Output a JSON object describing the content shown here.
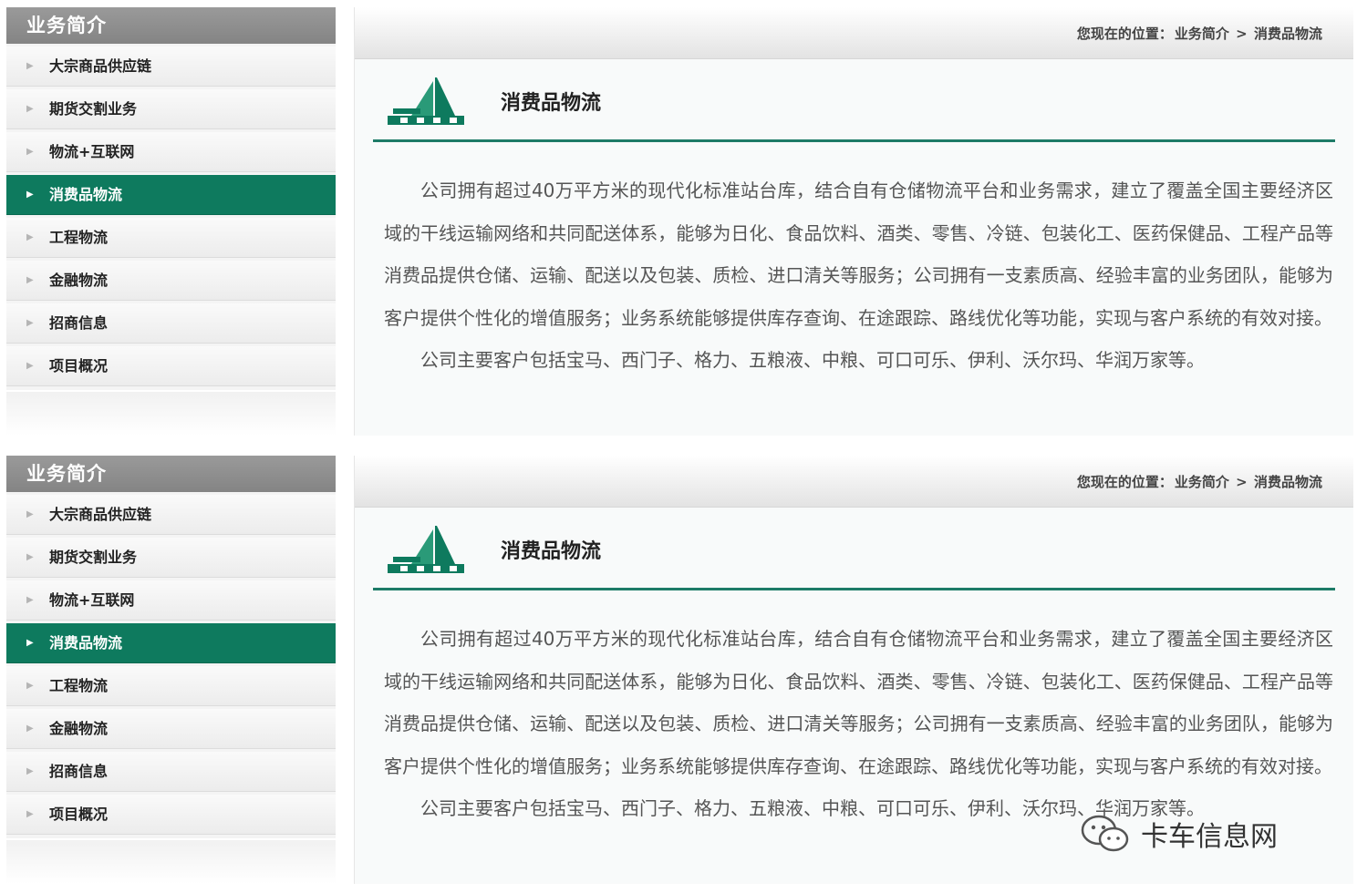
{
  "sidebar": {
    "title": "业务简介",
    "items": [
      {
        "label": "大宗商品供应链",
        "active": false
      },
      {
        "label": "期货交割业务",
        "active": false
      },
      {
        "label": "物流+互联网",
        "active": false
      },
      {
        "label": "消费品物流",
        "active": true
      },
      {
        "label": "工程物流",
        "active": false
      },
      {
        "label": "金融物流",
        "active": false
      },
      {
        "label": "招商信息",
        "active": false
      },
      {
        "label": "项目概况",
        "active": false
      }
    ]
  },
  "breadcrumb": {
    "prefix": "您现在的位置：",
    "parent": "业务简介",
    "separator": ">",
    "current": "消费品物流"
  },
  "page_title": "消费品物流",
  "paragraphs": [
    "公司拥有超过40万平方米的现代化标准站台库，结合自有仓储物流平台和业务需求，建立了覆盖全国主要经济区域的干线运输网络和共同配送体系，能够为日化、食品饮料、酒类、零售、冷链、包装化工、医药保健品、工程产品等消费品提供仓储、运输、配送以及包装、质检、进口清关等服务；公司拥有一支素质高、经验丰富的业务团队，能够为客户提供个性化的增值服务；业务系统能够提供库存查询、在途跟踪、路线优化等功能，实现与客户系统的有效对接。",
    "公司主要客户包括宝马、西门子、格力、五粮液、中粮、可口可乐、伊利、沃尔玛、华润万家等。"
  ],
  "watermark": "卡车信息网",
  "colors": {
    "accent": "#0e7a5e",
    "divider": "#1d7b67"
  }
}
